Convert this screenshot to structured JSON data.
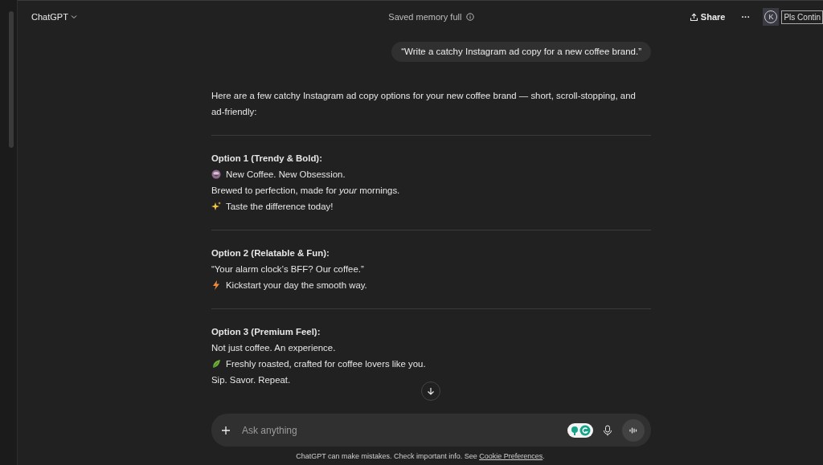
{
  "header": {
    "title": "ChatGPT",
    "memory_notice": "Saved memory full",
    "share": "Share",
    "more": "···",
    "avatar": "K",
    "extension_label": "Pls Contin"
  },
  "user_message": "“Write a catchy Instagram ad copy for a new coffee brand.”",
  "response": {
    "intro": "Here are a few catchy Instagram ad copy options for your new coffee brand — short, scroll-stopping, and ad-friendly:",
    "options": [
      {
        "heading": "Option 1 (Trendy & Bold):",
        "lines": [
          {
            "kind": "cup",
            "text": "New Coffee. New Obsession."
          },
          {
            "kind": "plain",
            "text": "Brewed to perfection, made for *your* mornings."
          },
          {
            "kind": "sparkles",
            "text": "Taste the difference today!"
          }
        ]
      },
      {
        "heading": "Option 2 (Relatable & Fun):",
        "lines": [
          {
            "kind": "plain",
            "text": "“Your alarm clock’s BFF? Our coffee.”"
          },
          {
            "kind": "bolt",
            "text": "Kickstart your day the smooth way."
          }
        ]
      },
      {
        "heading": "Option 3 (Premium Feel):",
        "lines": [
          {
            "kind": "plain",
            "text": "Not just coffee. An experience."
          },
          {
            "kind": "leaf",
            "text": "Freshly roasted, crafted for coffee lovers like you."
          },
          {
            "kind": "plain",
            "text": "Sip. Savor. Repeat."
          }
        ]
      }
    ]
  },
  "composer": {
    "placeholder": "Ask anything"
  },
  "footer": {
    "text": "ChatGPT can make mistakes. Check important info. See",
    "link": "Cookie Preferences",
    "end": "."
  }
}
